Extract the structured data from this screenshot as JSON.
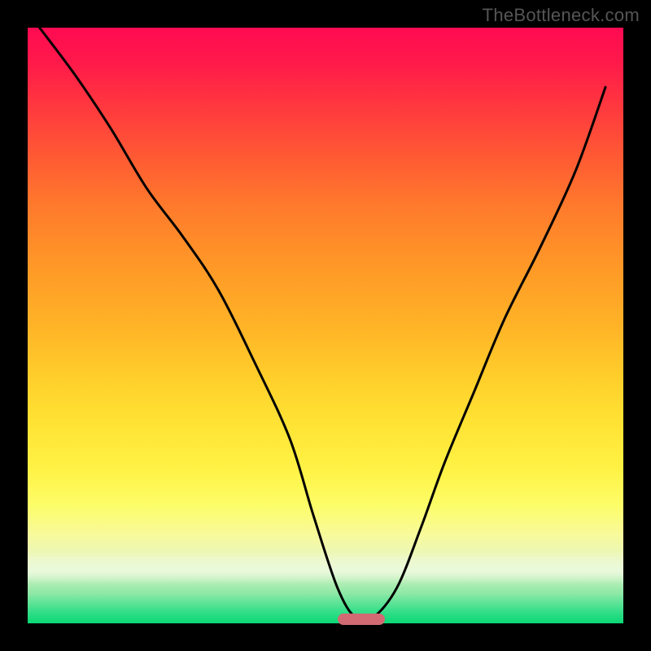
{
  "watermark": "TheBottleneck.com",
  "chart_data": {
    "type": "line",
    "title": "",
    "xlabel": "",
    "ylabel": "",
    "xlim": [
      0,
      100
    ],
    "ylim": [
      0,
      100
    ],
    "grid": false,
    "series": [
      {
        "name": "bottleneck-curve",
        "x": [
          2,
          8,
          14,
          20,
          26,
          32,
          38,
          44,
          48,
          52,
          55,
          58,
          62,
          66,
          70,
          75,
          80,
          86,
          92,
          97
        ],
        "values": [
          100,
          92,
          83,
          73,
          65,
          56,
          44,
          31,
          18,
          6,
          1,
          1,
          6,
          16,
          27,
          39,
          51,
          63,
          76,
          90
        ]
      }
    ],
    "annotations": [
      {
        "type": "marker-bar",
        "x_start": 52,
        "x_end": 60,
        "y": 0,
        "color": "#d16a72"
      }
    ],
    "background_gradient": {
      "direction": "vertical",
      "stops": [
        {
          "pos": 0,
          "color": "#ff0a52"
        },
        {
          "pos": 50,
          "color": "#ffb327"
        },
        {
          "pos": 80,
          "color": "#fdfd67"
        },
        {
          "pos": 100,
          "color": "#09d876"
        }
      ]
    }
  }
}
